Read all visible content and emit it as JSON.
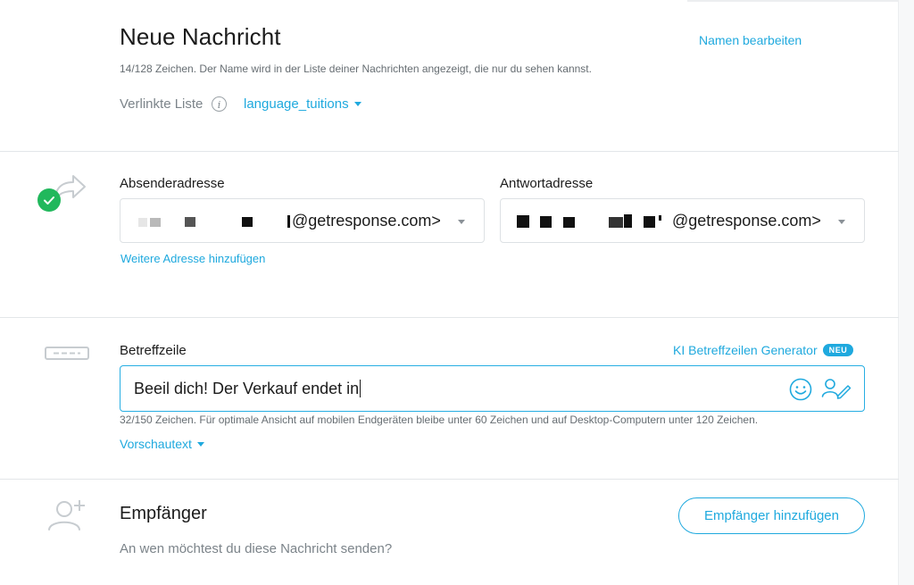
{
  "header": {
    "title": "Neue Nachricht",
    "edit_name_link": "Namen bearbeiten",
    "name_hint": "14/128 Zeichen. Der Name wird in der Liste deiner Nachrichten angezeigt, die nur du sehen kannst.",
    "linked_list_label": "Verlinkte Liste",
    "info_glyph": "i",
    "linked_list_value": "language_tuitions"
  },
  "sender": {
    "from_label": "Absenderadresse",
    "from_value": "@getresponse.com>",
    "reply_label": "Antwortadresse",
    "reply_value": "@getresponse.com>",
    "add_address_link": "Weitere Adresse hinzufügen",
    "status_color": "#21b85c"
  },
  "subject": {
    "label": "Betreffzeile",
    "ai_generator_link": "KI Betreffzeilen Generator",
    "new_badge": "NEU",
    "value": "Beeil dich! Der Verkauf endet in",
    "hint": "32/150 Zeichen. Für optimale Ansicht auf mobilen Endgeräten bleibe unter 60 Zeichen und auf Desktop-Computern unter 120 Zeichen.",
    "preview_link": "Vorschautext"
  },
  "recipients": {
    "title": "Empfänger",
    "subtitle": "An wen möchtest du diese Nachricht senden?",
    "add_button": "Empfänger hinzufügen"
  },
  "colors": {
    "accent": "#1fa9de",
    "success": "#21b85c",
    "border": "#dde1e4"
  }
}
